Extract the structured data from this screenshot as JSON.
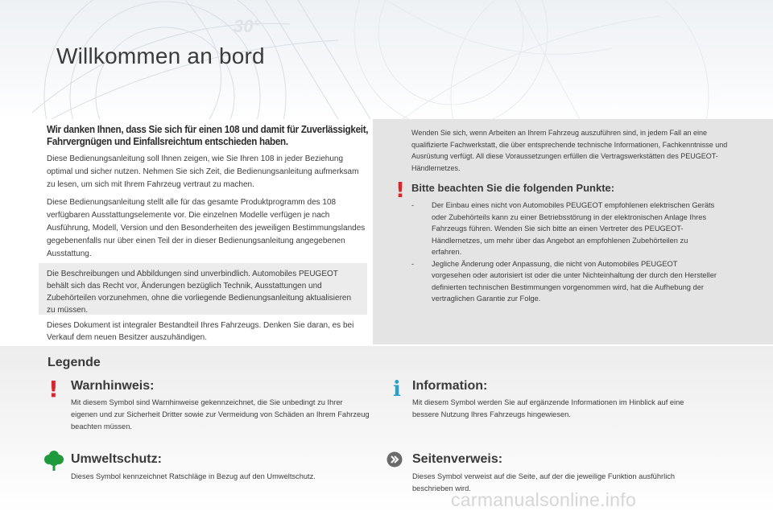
{
  "header": {
    "title": "Willkommen an bord"
  },
  "intro": {
    "heading": "Wir danken Ihnen, dass Sie sich für einen 108 und damit für Zuverlässigkeit, Fahrvergnügen und Einfallsreichtum entschieden haben.",
    "paragraphs": [
      "Diese Bedienungsanleitung soll Ihnen zeigen, wie Sie Ihren 108 in jeder Beziehung optimal und sicher nutzen. Nehmen Sie sich Zeit, die Bedienungsanleitung aufmerksam zu lesen, um sich mit Ihrem Fahrzeug vertraut zu machen.",
      "Diese Bedienungsanleitung stellt alle für das gesamte Produktprogramm des 108 verfügbaren Ausstattungselemente vor. Die einzelnen Modelle verfügen je nach Ausführung, Modell, Version und den Besonderheiten des jeweiligen Bestimmungslandes gegebenenfalls nur über einen Teil der in dieser Bedienungsanleitung angegebenen Ausstattung."
    ],
    "disclaimer": "Die Beschreibungen und Abbildungen sind unverbindlich. Automobiles PEUGEOT behält sich das Recht vor, Änderungen bezüglich Technik, Ausstattungen und Zubehörteilen vorzunehmen, ohne die vorliegende Bedienungsanleitung aktualisieren zu müssen.",
    "closing": "Dieses Dokument ist integraler Bestandteil Ihres Fahrzeugs. Denken Sie daran, es bei Verkauf dem neuen Besitzer auszuhändigen."
  },
  "notice": {
    "intro": "Wenden Sie sich, wenn Arbeiten an Ihrem Fahrzeug auszuführen sind, in jedem Fall an eine qualifizierte Fachwerkstatt, die über entsprechende technische Informationen, Fachkenntnisse und Ausrüstung verfügt. All diese Voraussetzungen erfüllen die Vertragswerkstätten des PEUGEOT-Händlernetzes.",
    "icon": "!",
    "heading": "Bitte beachten Sie die folgenden Punkte:",
    "items": [
      "Der Einbau eines nicht von Automobiles PEUGEOT empfohlenen elektrischen Geräts oder Zubehörteils kann zu einer Betriebsstörung in der elektronischen Anlage Ihres Fahrzeugs führen. Wenden Sie sich bitte an einen Vertreter des PEUGEOT-Händlernetzes, um mehr über das Angebot an empfohlenen Zubehörteilen zu erfahren.",
      "Jegliche Änderung oder Anpassung, die nicht von Automobiles PEUGEOT vorgesehen oder autorisiert ist oder die unter Nichteinhaltung der durch den Hersteller definierten technischen Bestimmungen vorgenommen wird, hat die Aufhebung der vertraglichen Garantie zur Folge."
    ],
    "dash": "-"
  },
  "legend": {
    "title": "Legende",
    "warning": {
      "icon": "!",
      "heading": "Warnhinweis:",
      "text": "Mit diesem Symbol sind Warnhinweise gekennzeichnet, die Sie unbedingt zu Ihrer eigenen und zur Sicherheit Dritter sowie zur Vermeidung von Schäden an Ihrem Fahrzeug beachten müssen."
    },
    "information": {
      "icon": "i",
      "heading": "Information:",
      "text": "Mit diesem Symbol werden Sie auf ergänzende Informationen im Hinblick auf eine bessere Nutzung Ihres Fahrzeugs hingewiesen."
    },
    "environment": {
      "heading": "Umweltschutz:",
      "text": "Dieses Symbol kennzeichnet Ratschläge in Bezug auf den Umweltschutz."
    },
    "crossref": {
      "heading": "Seitenverweis:",
      "text": "Dieses Symbol verweist auf die Seite, auf der die jeweilige Funktion ausführlich beschrieben wird."
    }
  },
  "watermark": "carmanualsonline.info",
  "colors": {
    "warning": "#d9262e",
    "info": "#2aa0c8",
    "environment": "#1f9a3c",
    "crossref": "#6a6a6a"
  },
  "icons": {
    "warning": "exclamation-icon",
    "information": "info-icon",
    "environment": "tree-icon",
    "crossref": "double-chevron-icon"
  }
}
